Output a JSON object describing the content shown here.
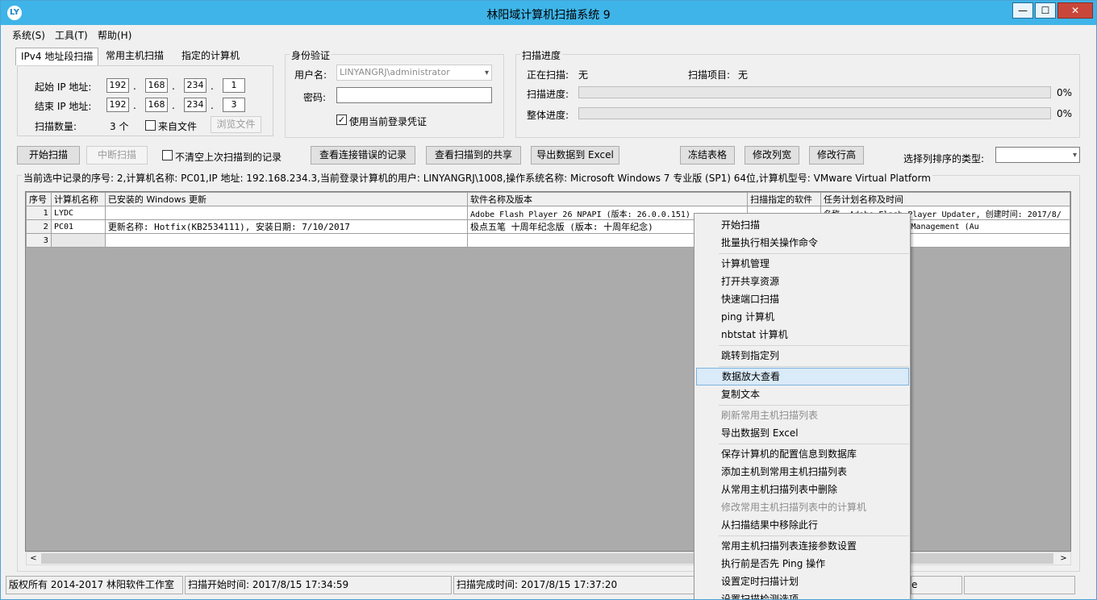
{
  "app": {
    "title": "林阳域计算机扫描系统 9",
    "icon": "LY"
  },
  "window_controls": {
    "minimize": "—",
    "maximize": "☐",
    "close": "✕"
  },
  "menu": [
    "系统(S)",
    "工具(T)",
    "帮助(H)"
  ],
  "tabs": [
    "IPv4 地址段扫描",
    "常用主机扫描",
    "指定的计算机"
  ],
  "ip_range": {
    "start_label": "起始 IP 地址:",
    "start": [
      "192",
      "168",
      "234",
      "1"
    ],
    "end_label": "结束 IP 地址:",
    "end": [
      "192",
      "168",
      "234",
      "3"
    ],
    "count_label": "扫描数量:",
    "count_value": "3 个",
    "from_file_label": "来自文件",
    "browse_label": "浏览文件",
    "dot": "."
  },
  "auth": {
    "title": "身份验证",
    "username_label": "用户名:",
    "username_value": "LINYANGRJ\\administrator",
    "password_label": "密码:",
    "password_value": "",
    "use_current_label": "使用当前登录凭证",
    "use_current_checked": "✓"
  },
  "progress": {
    "title": "扫描进度",
    "scanning_label": "正在扫描:",
    "scanning_value": "无",
    "item_label": "扫描项目:",
    "item_value": "无",
    "scan_progress_label": "扫描进度:",
    "scan_progress_pct": "0%",
    "scan_progress_fraction": 0,
    "overall_label": "整体进度:",
    "overall_pct": "0%",
    "overall_fraction": 0
  },
  "toolbar": {
    "start": "开始扫描",
    "stop": "中断扫描",
    "keep_label": "不清空上次扫描到的记录",
    "view_errors": "查看连接错误的记录",
    "view_shares": "查看扫描到的共享",
    "export": "导出数据到 Excel",
    "freeze": "冻结表格",
    "col_width": "修改列宽",
    "row_height": "修改行高",
    "sort_label": "选择列排序的类型:",
    "sort_value": ""
  },
  "info_line": "当前选中记录的序号: 2,计算机名称: PC01,IP 地址: 192.168.234.3,当前登录计算机的用户: LINYANGRJ\\1008,操作系统名称: Microsoft Windows 7 专业版 (SP1) 64位,计算机型号: VMware Virtual Platform",
  "grid": {
    "columns": [
      "序号",
      "计算机名称",
      "已安装的 Windows 更新",
      "软件名称及版本",
      "扫描指定的软件",
      "任务计划名称及时间"
    ],
    "rows": [
      [
        "1",
        "LYDC",
        "",
        "Adobe Flash Player 26 NPAPI (版本: 26.0.0.151)",
        "",
        "名称: Adobe Flash Player Updater, 创建时间: 2017/8/"
      ],
      [
        "2",
        "PC01",
        "更新名称: Hotfix(KB2534111), 安装日期: 7/10/2017",
        "极点五笔 十周年纪念版 (版本: 十周年纪念)",
        "",
        "s Policy Template Management (Au"
      ],
      [
        "3",
        "",
        "",
        "",
        "",
        ""
      ]
    ]
  },
  "scroll": {
    "left": "<",
    "right": ">"
  },
  "status": {
    "copyright": "版权所有 2014-2017 林阳软件工作室",
    "start_time": "扫描开始时间: 2017/8/15 17:34:59",
    "end_time": "扫描完成时间: 2017/8/15 17:37:20",
    "extra": "e"
  },
  "context_menu": [
    {
      "label": "开始扫描",
      "state": "normal"
    },
    {
      "label": "批量执行相关操作命令",
      "state": "normal"
    },
    {
      "sep": true
    },
    {
      "label": "计算机管理",
      "state": "normal"
    },
    {
      "label": "打开共享资源",
      "state": "normal"
    },
    {
      "label": "快速端口扫描",
      "state": "normal"
    },
    {
      "label": "ping 计算机",
      "state": "normal"
    },
    {
      "label": "nbtstat 计算机",
      "state": "normal"
    },
    {
      "sep": true
    },
    {
      "label": "跳转到指定列",
      "state": "normal"
    },
    {
      "sep": true
    },
    {
      "label": "数据放大查看",
      "state": "highlighted"
    },
    {
      "label": "复制文本",
      "state": "normal"
    },
    {
      "sep": true
    },
    {
      "label": "刷新常用主机扫描列表",
      "state": "disabled"
    },
    {
      "label": "导出数据到 Excel",
      "state": "normal"
    },
    {
      "sep": true
    },
    {
      "label": "保存计算机的配置信息到数据库",
      "state": "normal"
    },
    {
      "label": "添加主机到常用主机扫描列表",
      "state": "normal"
    },
    {
      "label": "从常用主机扫描列表中删除",
      "state": "normal"
    },
    {
      "label": "修改常用主机扫描列表中的计算机",
      "state": "disabled"
    },
    {
      "label": "从扫描结果中移除此行",
      "state": "normal"
    },
    {
      "sep": true
    },
    {
      "label": "常用主机扫描列表连接参数设置",
      "state": "normal"
    },
    {
      "label": "执行前是否先 Ping 操作",
      "state": "normal"
    },
    {
      "label": "设置定时扫描计划",
      "state": "normal"
    },
    {
      "label": "设置扫描检测选项",
      "state": "normal"
    }
  ]
}
